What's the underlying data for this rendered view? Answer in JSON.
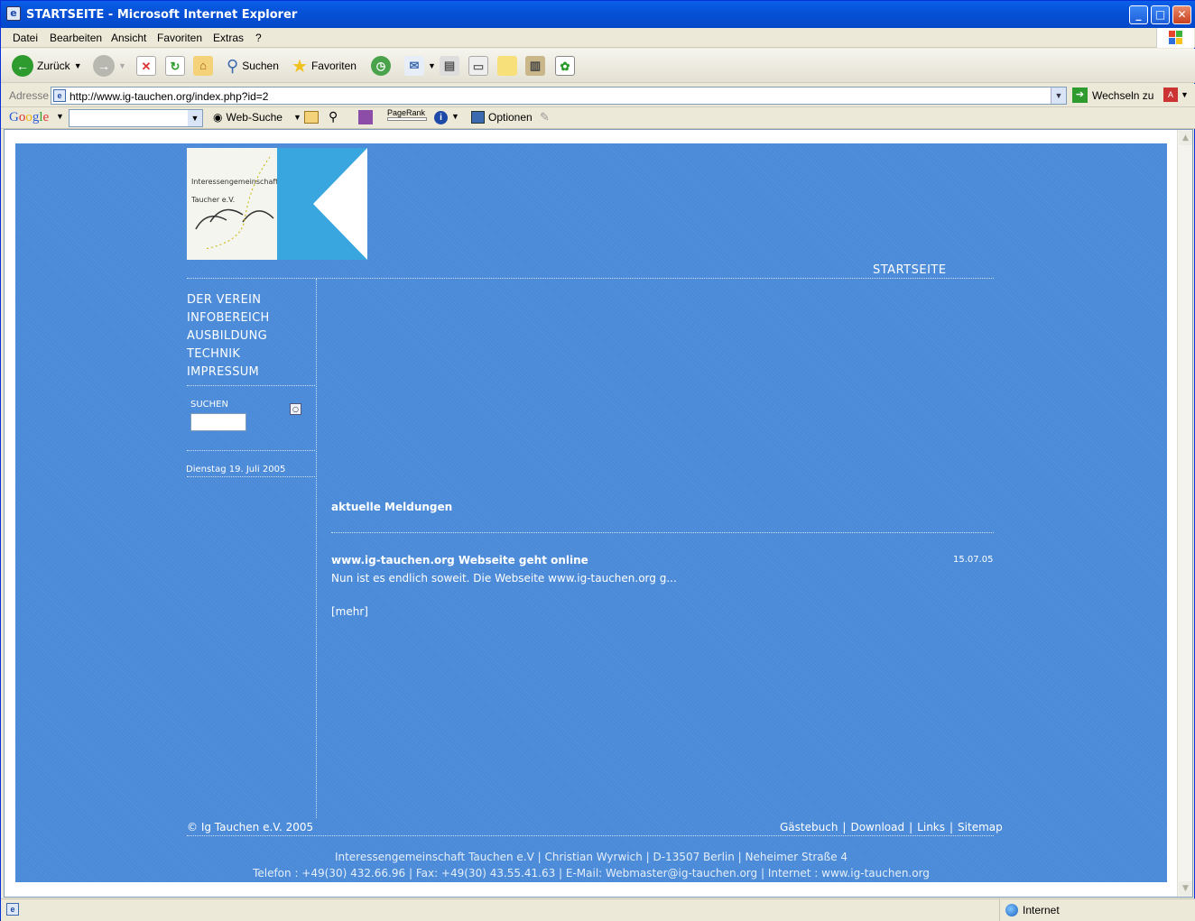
{
  "window": {
    "title": "STARTSEITE - Microsoft Internet Explorer"
  },
  "menu": [
    "Datei",
    "Bearbeiten",
    "Ansicht",
    "Favoriten",
    "Extras",
    "?"
  ],
  "toolbar": {
    "back_label": "Zurück",
    "search_label": "Suchen",
    "favorites_label": "Favoriten"
  },
  "address": {
    "label": "Adresse",
    "url": "http://www.ig-tauchen.org/index.php?id=2",
    "go_label": "Wechseln zu"
  },
  "googlebar": {
    "logo": "Google",
    "websearch_label": "Web-Suche",
    "pagerank_label": "PageRank",
    "options_label": "Optionen"
  },
  "site": {
    "logo_text_line1": "Interessengemeinschaft",
    "logo_text_line2": "Taucher e.V.",
    "page_heading": "STARTSEITE",
    "nav": [
      "DER VEREIN",
      "INFOBEREICH",
      "AUSBILDUNG",
      "TECHNIK",
      "IMPRESSUM"
    ],
    "search_label": "SUCHEN",
    "date": "Dienstag 19. Juli 2005",
    "news_heading": "aktuelle Meldungen",
    "news": {
      "title": "www.ig-tauchen.org Webseite geht online",
      "date": "15.07.05",
      "teaser": "Nun ist es endlich soweit. Die Webseite www.ig-tauchen.org g...",
      "more": "[mehr]"
    },
    "copyright": "© Ig Tauchen e.V. 2005",
    "footer_links": [
      "Gästebuch",
      "Download",
      "Links",
      "Sitemap"
    ],
    "address_line1": "Interessengemeinschaft Tauchen e.V | Christian Wyrwich | D-13507 Berlin | Neheimer Straße 4",
    "address_line2": "Telefon : +49(30) 432.66.96 | Fax: +49(30) 43.55.41.63 | E-Mail: Webmaster@ig-tauchen.org | Internet : www.ig-tauchen.org"
  },
  "status": {
    "zone": "Internet"
  },
  "colors": {
    "page_bg": "#4a8ad8",
    "logo_accent": "#3aa6e0"
  }
}
